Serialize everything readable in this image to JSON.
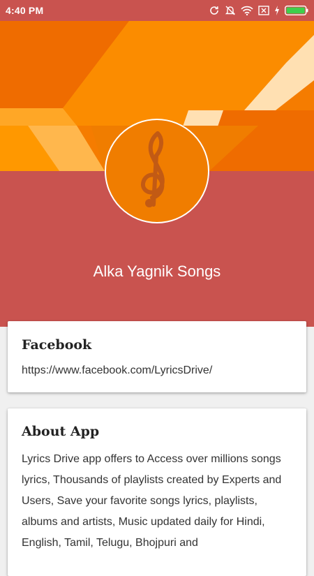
{
  "status_bar": {
    "time": "4:40 PM",
    "icons": [
      "sync-icon",
      "notifications-off-icon",
      "wifi-icon",
      "no-sim-icon",
      "charging-icon",
      "battery-icon"
    ]
  },
  "header": {
    "title": "Alka Yagnik Songs",
    "icon": "treble-clef-icon",
    "colors": {
      "header_red": "#c9534f",
      "banner_orange": "#f07d00",
      "banner_light": "#ffb74d",
      "banner_cream": "#ffe0b2"
    }
  },
  "cards": {
    "facebook": {
      "title": "Facebook",
      "link": "https://www.facebook.com/LyricsDrive/"
    },
    "about": {
      "title": "About App",
      "text": "Lyrics Drive app offers to Access over millions songs lyrics, Thousands of playlists created by Experts and Users, Save your favorite songs lyrics, playlists, albums and artists, Music updated daily for Hindi, English, Tamil, Telugu, Bhojpuri and"
    }
  }
}
